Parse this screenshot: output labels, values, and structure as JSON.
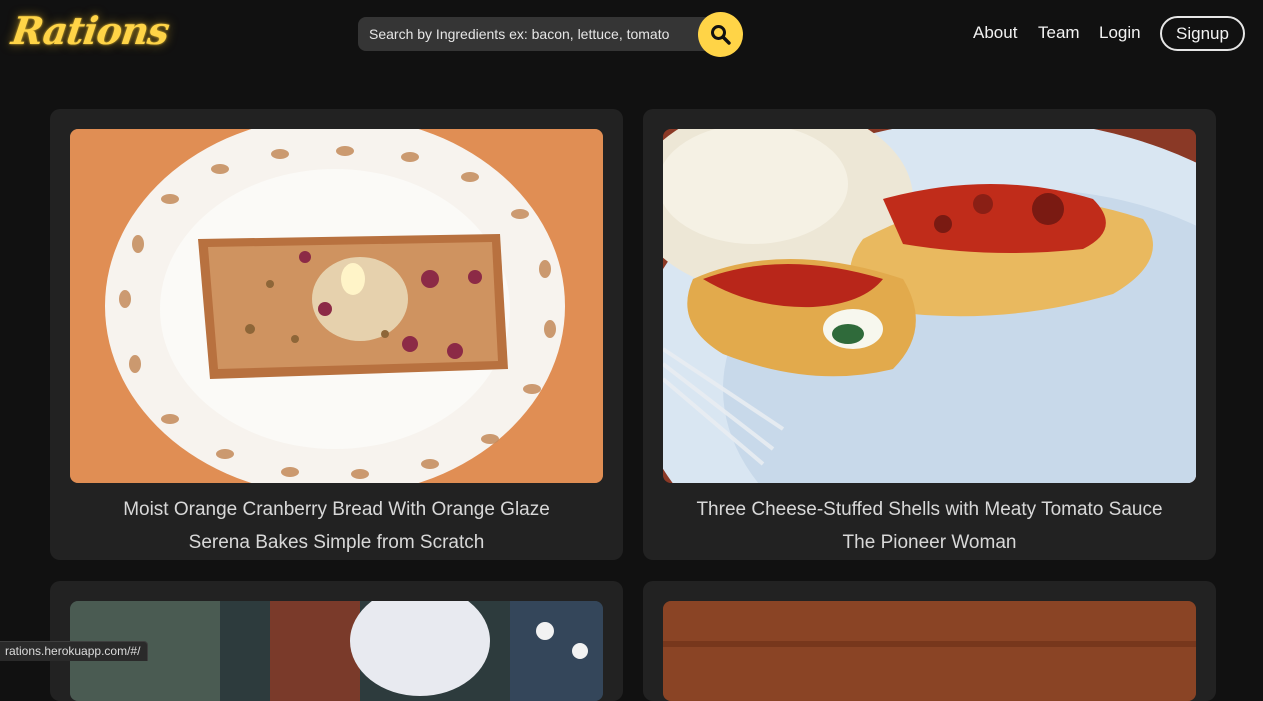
{
  "app": {
    "logo": "Rations",
    "accent_color": "#ffd447"
  },
  "search": {
    "placeholder": "Search by Ingredients ex: bacon, lettuce, tomato",
    "value": "",
    "button_icon": "search-icon"
  },
  "nav": {
    "about": "About",
    "team": "Team",
    "login": "Login",
    "signup": "Signup"
  },
  "recipes": [
    {
      "title": "Moist Orange Cranberry Bread With Orange Glaze",
      "source": "Serena Bakes Simple from Scratch",
      "image": "cranberry-bread-slice-on-lace-plate"
    },
    {
      "title": "Three Cheese-Stuffed Shells with Meaty Tomato Sauce",
      "source": "The Pioneer Woman",
      "image": "stuffed-shells-with-tomato-sauce"
    },
    {
      "title": "",
      "source": "",
      "image": "partially-visible-recipe-photo"
    },
    {
      "title": "",
      "source": "",
      "image": "partially-visible-recipe-photo"
    }
  ],
  "status_bar": {
    "url": "rations.herokuapp.com/#/"
  }
}
